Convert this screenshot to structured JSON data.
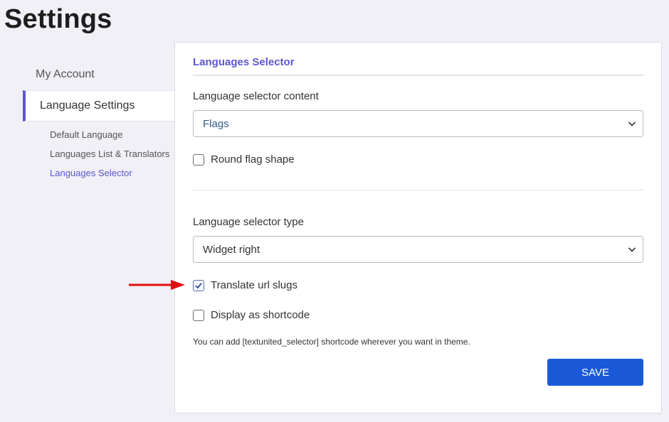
{
  "page": {
    "title": "Settings"
  },
  "sidebar": {
    "items": [
      {
        "label": "My Account"
      },
      {
        "label": "Language Settings"
      }
    ],
    "subitems": [
      {
        "label": "Default Language"
      },
      {
        "label": "Languages List & Translators"
      },
      {
        "label": "Languages Selector"
      }
    ]
  },
  "panel": {
    "title": "Languages Selector",
    "content_label": "Language selector content",
    "content_value": "Flags",
    "round_flag_label": "Round flag shape",
    "round_flag_checked": false,
    "type_label": "Language selector type",
    "type_value": "Widget right",
    "translate_slugs_label": "Translate url slugs",
    "translate_slugs_checked": true,
    "shortcode_label": "Display as shortcode",
    "shortcode_checked": false,
    "hint": "You can add [textunited_selector] shortcode wherever you want in theme.",
    "save_label": "SAVE"
  },
  "colors": {
    "accent": "#5b57d1",
    "primary_button": "#1a5ad9",
    "annotation_arrow": "#e01010",
    "select_value_text": "#2f5a8a"
  },
  "icons": [
    "chevron-down-icon",
    "checkmark-icon",
    "red-arrow-icon"
  ]
}
